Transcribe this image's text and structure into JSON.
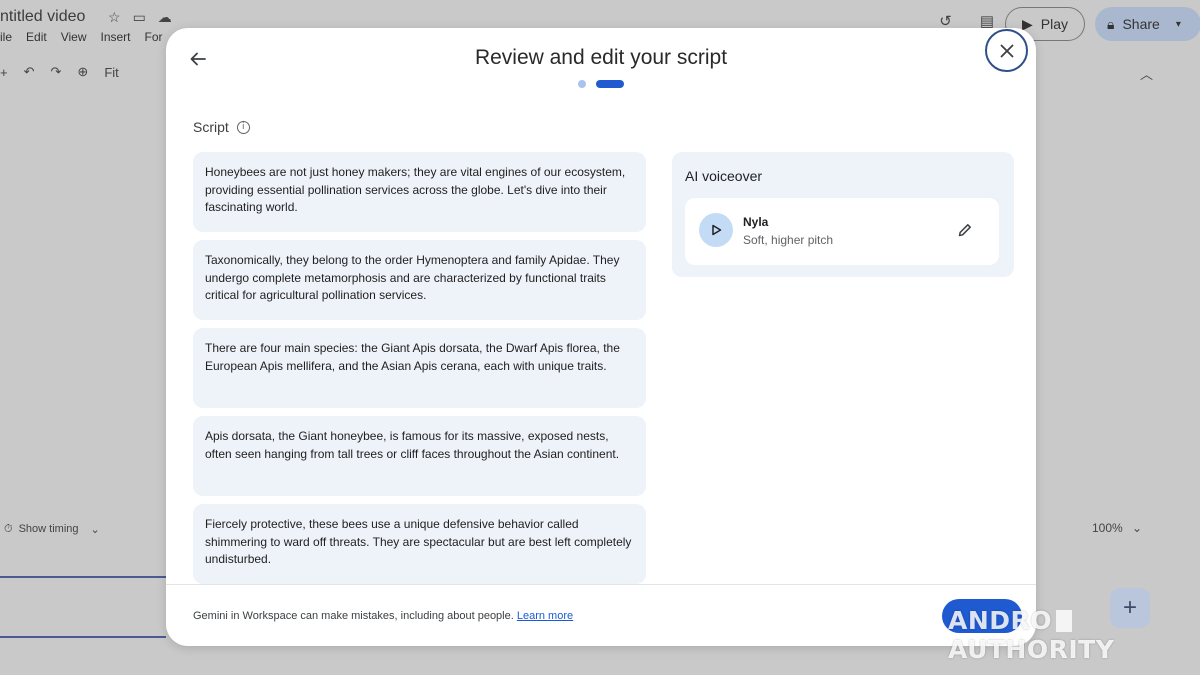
{
  "background": {
    "doc_title": "ntitled video",
    "menu": [
      "ile",
      "Edit",
      "View",
      "Insert",
      "For"
    ],
    "toolbar": {
      "zoom_fit": "Fit"
    },
    "play_label": "Play",
    "share_label": "Share",
    "show_timing_label": "Show timing",
    "zoom_level": "100%"
  },
  "modal": {
    "title": "Review and edit your script",
    "steps": {
      "total": 2,
      "current": 2
    },
    "script_label": "Script",
    "script_paragraphs": [
      "Honeybees are not just honey makers; they are vital engines of our ecosystem, providing essential pollination services across the globe. Let's dive into their fascinating world.",
      "Taxonomically, they belong to the order Hymenoptera and family Apidae. They undergo complete metamorphosis and are characterized by functional traits critical for agricultural pollination services.",
      "There are four main species: the Giant Apis dorsata, the Dwarf Apis florea, the European Apis mellifera, and the Asian Apis cerana, each with unique traits.",
      "Apis dorsata, the Giant honeybee, is famous for its massive, exposed nests, often seen hanging from tall trees or cliff faces throughout the Asian continent.",
      "Fiercely protective, these bees use a unique defensive behavior called shimmering to ward off threats. They are spectacular but are best left completely undisturbed."
    ],
    "voiceover": {
      "title": "AI voiceover",
      "voice_name": "Nyla",
      "voice_description": "Soft, higher pitch"
    },
    "footer": {
      "disclaimer": "Gemini in Workspace can make mistakes, including about people.",
      "learn_more": "Learn more"
    }
  },
  "watermark": {
    "left": "ANDRO",
    "right": "AUTHORITY"
  },
  "colors": {
    "accent": "#1f5ad1",
    "card_bg": "#eef2f9",
    "close_ring": "#2f4f8a"
  }
}
